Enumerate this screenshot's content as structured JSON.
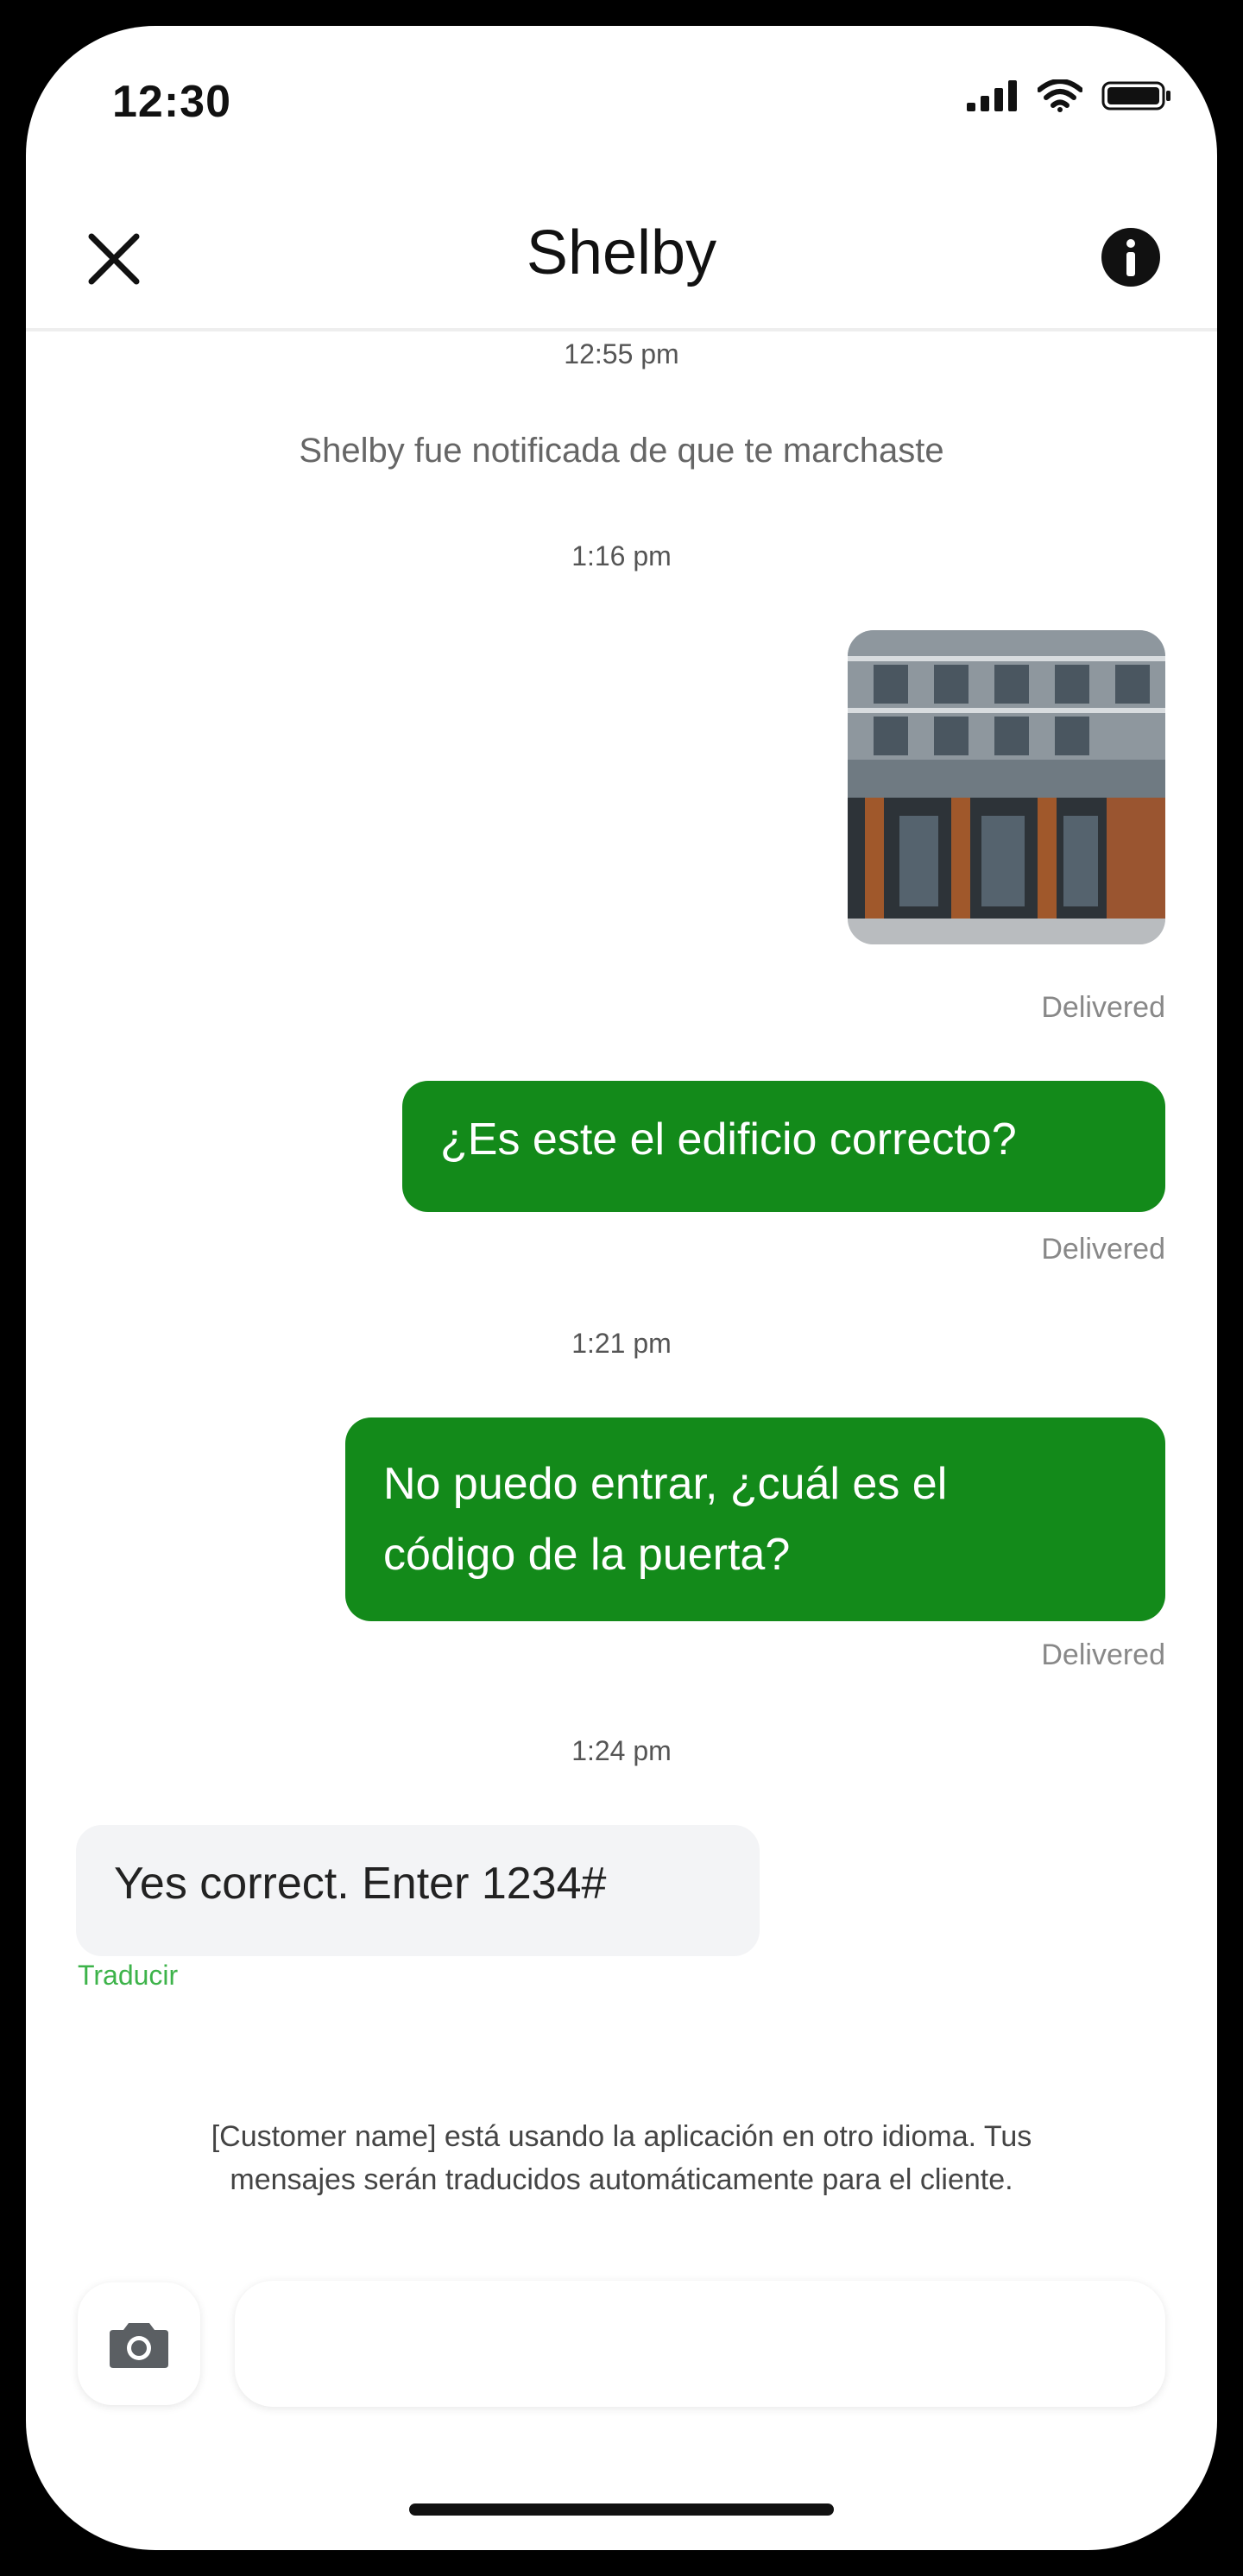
{
  "status_bar": {
    "time": "12:30"
  },
  "header": {
    "title": "Shelby",
    "close_icon": "close-icon",
    "info_icon": "info-icon"
  },
  "conversation": {
    "ts1": "12:55 pm",
    "system_message": "Shelby fue notificada de que te marchaste",
    "ts2": "1:16 pm",
    "photo_status": "Delivered",
    "msg1": {
      "text": "¿Es este el edificio correcto?",
      "status": "Delivered"
    },
    "ts3": "1:21 pm",
    "msg2": {
      "line1": "No puedo entrar, ¿cuál es el",
      "line2": "código de la puerta?",
      "status": "Delivered"
    },
    "ts4": "1:24 pm",
    "reply": {
      "text": "Yes correct. Enter 1234#",
      "translate": "Traducir"
    }
  },
  "notice": {
    "line1": "[Customer name] está usando la aplicación en otro idioma. Tus",
    "line2": "mensajes serán traducidos automáticamente para el cliente."
  },
  "composer": {
    "camera_icon": "camera-icon",
    "input_value": ""
  },
  "colors": {
    "outgoing_bubble": "#138a1a",
    "incoming_bubble": "#f3f4f6",
    "link": "#3db34a"
  }
}
